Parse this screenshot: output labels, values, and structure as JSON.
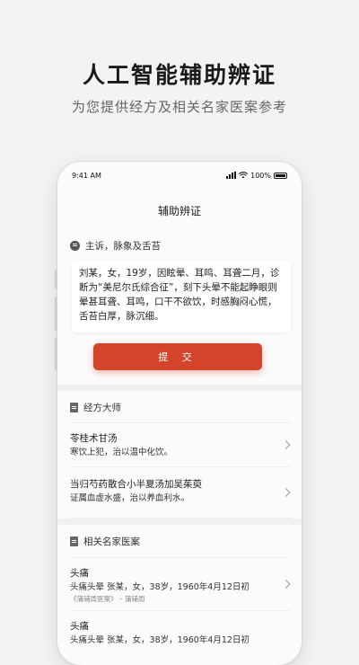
{
  "hero": {
    "title": "人工智能辅助辨证",
    "subtitle": "为您提供经方及相关名家医案参考"
  },
  "status_bar": {
    "time": "9:41 AM",
    "battery": "100%"
  },
  "nav": {
    "title": "辅助辨证"
  },
  "complaint": {
    "heading": "主诉，脉象及舌苔",
    "text": "刘某，女，19岁，因眩晕、耳鸣、耳聋二月，诊断为“美尼尔氏综合征”，刻下头晕不能起睁眼则晕甚耳聋、耳鸣，口干不欲饮，时感胸闷心慌，舌苔白厚，脉沉细。"
  },
  "submit_label": "提 交",
  "classic_formulas": {
    "heading": "经方大师",
    "items": [
      {
        "title": "苓桂术甘汤",
        "desc": "寒饮上犯，治以温中化饮。"
      },
      {
        "title": "当归芍药散合小半夏汤加吴茱萸",
        "desc": "证属血虚水盛，治以养血利水。"
      }
    ]
  },
  "cases": {
    "heading": "相关名家医案",
    "items": [
      {
        "title": "头痛",
        "desc": "头痛头晕 张某，女，38岁，1960年4月12日初",
        "source": "《蒲辅周医案》 – 蒲辅周"
      },
      {
        "title": "头痛",
        "desc": "头痛头晕 张某，女，38岁，1960年4月12日初"
      }
    ]
  },
  "colors": {
    "accent": "#d4442a",
    "background": "#f4f3f2"
  },
  "icons": [
    "chat-bubble-icon",
    "document-icon",
    "chevron-right-icon",
    "signal-icon",
    "wifi-icon",
    "battery-icon"
  ]
}
